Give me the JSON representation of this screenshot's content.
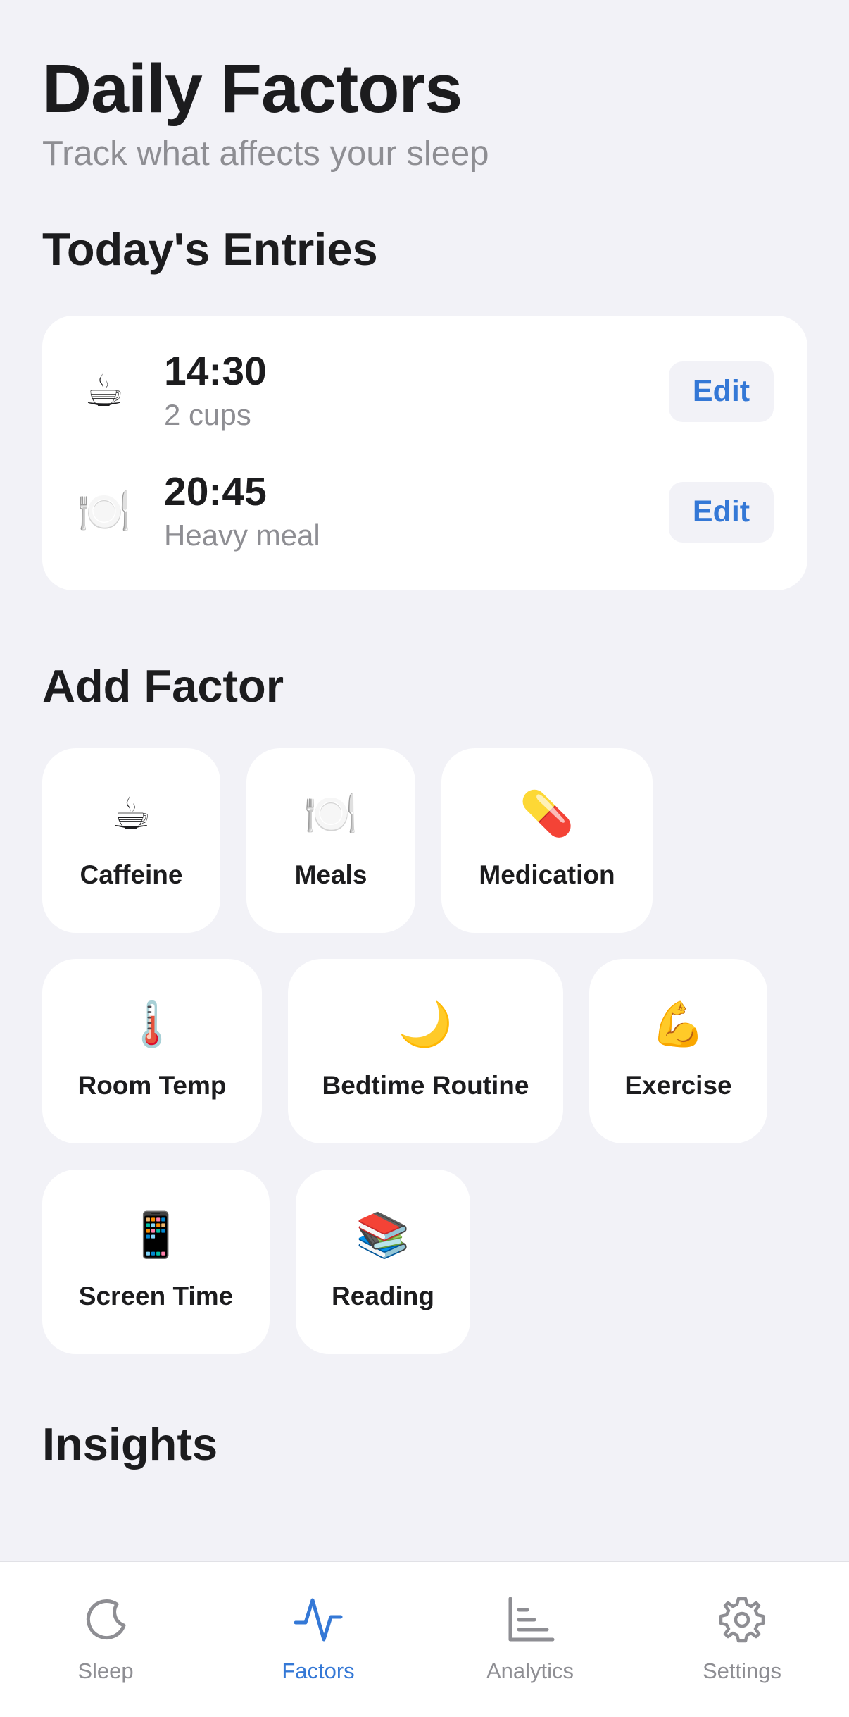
{
  "header": {
    "title": "Daily Factors",
    "subtitle": "Track what affects your sleep"
  },
  "entries": {
    "title": "Today's Entries",
    "items": [
      {
        "icon": "coffee-icon",
        "emoji": "☕",
        "time": "14:30",
        "detail": "2 cups",
        "edit_label": "Edit"
      },
      {
        "icon": "plate-icon",
        "emoji": "🍽️",
        "time": "20:45",
        "detail": "Heavy meal",
        "edit_label": "Edit"
      }
    ]
  },
  "add_factor": {
    "title": "Add Factor",
    "items": [
      {
        "icon": "coffee-icon",
        "emoji": "☕",
        "label": "Caffeine"
      },
      {
        "icon": "plate-icon",
        "emoji": "🍽️",
        "label": "Meals"
      },
      {
        "icon": "pill-icon",
        "emoji": "💊",
        "label": "Medication"
      },
      {
        "icon": "thermometer-icon",
        "emoji": "🌡️",
        "label": "Room Temp"
      },
      {
        "icon": "moon-icon",
        "emoji": "🌙",
        "label": "Bedtime Routine"
      },
      {
        "icon": "flexed-bicep-icon",
        "emoji": "💪",
        "label": "Exercise"
      },
      {
        "icon": "phone-icon",
        "emoji": "📱",
        "label": "Screen Time"
      },
      {
        "icon": "books-icon",
        "emoji": "📚",
        "label": "Reading"
      }
    ]
  },
  "insights": {
    "title": "Insights"
  },
  "tabbar": {
    "active_color": "#3478d6",
    "inactive_color": "#8e8e93",
    "tabs": [
      {
        "icon": "moon-icon",
        "label": "Sleep",
        "active": false
      },
      {
        "icon": "activity-icon",
        "label": "Factors",
        "active": true
      },
      {
        "icon": "bar-chart-icon",
        "label": "Analytics",
        "active": false
      },
      {
        "icon": "gear-icon",
        "label": "Settings",
        "active": false
      }
    ]
  }
}
